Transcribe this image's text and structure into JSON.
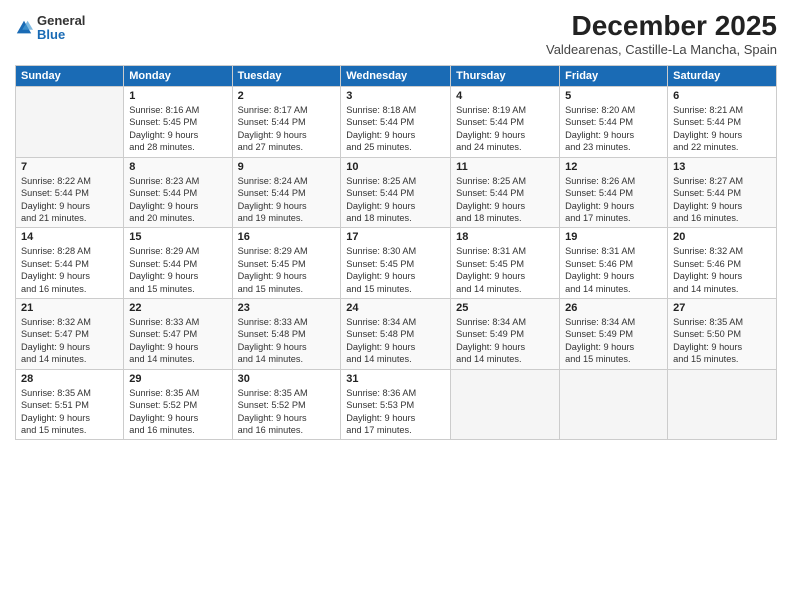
{
  "logo": {
    "general": "General",
    "blue": "Blue"
  },
  "header": {
    "title": "December 2025",
    "subtitle": "Valdearenas, Castille-La Mancha, Spain"
  },
  "calendar": {
    "days_of_week": [
      "Sunday",
      "Monday",
      "Tuesday",
      "Wednesday",
      "Thursday",
      "Friday",
      "Saturday"
    ],
    "weeks": [
      [
        {
          "day": "",
          "info": ""
        },
        {
          "day": "1",
          "info": "Sunrise: 8:16 AM\nSunset: 5:45 PM\nDaylight: 9 hours\nand 28 minutes."
        },
        {
          "day": "2",
          "info": "Sunrise: 8:17 AM\nSunset: 5:44 PM\nDaylight: 9 hours\nand 27 minutes."
        },
        {
          "day": "3",
          "info": "Sunrise: 8:18 AM\nSunset: 5:44 PM\nDaylight: 9 hours\nand 25 minutes."
        },
        {
          "day": "4",
          "info": "Sunrise: 8:19 AM\nSunset: 5:44 PM\nDaylight: 9 hours\nand 24 minutes."
        },
        {
          "day": "5",
          "info": "Sunrise: 8:20 AM\nSunset: 5:44 PM\nDaylight: 9 hours\nand 23 minutes."
        },
        {
          "day": "6",
          "info": "Sunrise: 8:21 AM\nSunset: 5:44 PM\nDaylight: 9 hours\nand 22 minutes."
        }
      ],
      [
        {
          "day": "7",
          "info": "Sunrise: 8:22 AM\nSunset: 5:44 PM\nDaylight: 9 hours\nand 21 minutes."
        },
        {
          "day": "8",
          "info": "Sunrise: 8:23 AM\nSunset: 5:44 PM\nDaylight: 9 hours\nand 20 minutes."
        },
        {
          "day": "9",
          "info": "Sunrise: 8:24 AM\nSunset: 5:44 PM\nDaylight: 9 hours\nand 19 minutes."
        },
        {
          "day": "10",
          "info": "Sunrise: 8:25 AM\nSunset: 5:44 PM\nDaylight: 9 hours\nand 18 minutes."
        },
        {
          "day": "11",
          "info": "Sunrise: 8:25 AM\nSunset: 5:44 PM\nDaylight: 9 hours\nand 18 minutes."
        },
        {
          "day": "12",
          "info": "Sunrise: 8:26 AM\nSunset: 5:44 PM\nDaylight: 9 hours\nand 17 minutes."
        },
        {
          "day": "13",
          "info": "Sunrise: 8:27 AM\nSunset: 5:44 PM\nDaylight: 9 hours\nand 16 minutes."
        }
      ],
      [
        {
          "day": "14",
          "info": "Sunrise: 8:28 AM\nSunset: 5:44 PM\nDaylight: 9 hours\nand 16 minutes."
        },
        {
          "day": "15",
          "info": "Sunrise: 8:29 AM\nSunset: 5:44 PM\nDaylight: 9 hours\nand 15 minutes."
        },
        {
          "day": "16",
          "info": "Sunrise: 8:29 AM\nSunset: 5:45 PM\nDaylight: 9 hours\nand 15 minutes."
        },
        {
          "day": "17",
          "info": "Sunrise: 8:30 AM\nSunset: 5:45 PM\nDaylight: 9 hours\nand 15 minutes."
        },
        {
          "day": "18",
          "info": "Sunrise: 8:31 AM\nSunset: 5:45 PM\nDaylight: 9 hours\nand 14 minutes."
        },
        {
          "day": "19",
          "info": "Sunrise: 8:31 AM\nSunset: 5:46 PM\nDaylight: 9 hours\nand 14 minutes."
        },
        {
          "day": "20",
          "info": "Sunrise: 8:32 AM\nSunset: 5:46 PM\nDaylight: 9 hours\nand 14 minutes."
        }
      ],
      [
        {
          "day": "21",
          "info": "Sunrise: 8:32 AM\nSunset: 5:47 PM\nDaylight: 9 hours\nand 14 minutes."
        },
        {
          "day": "22",
          "info": "Sunrise: 8:33 AM\nSunset: 5:47 PM\nDaylight: 9 hours\nand 14 minutes."
        },
        {
          "day": "23",
          "info": "Sunrise: 8:33 AM\nSunset: 5:48 PM\nDaylight: 9 hours\nand 14 minutes."
        },
        {
          "day": "24",
          "info": "Sunrise: 8:34 AM\nSunset: 5:48 PM\nDaylight: 9 hours\nand 14 minutes."
        },
        {
          "day": "25",
          "info": "Sunrise: 8:34 AM\nSunset: 5:49 PM\nDaylight: 9 hours\nand 14 minutes."
        },
        {
          "day": "26",
          "info": "Sunrise: 8:34 AM\nSunset: 5:49 PM\nDaylight: 9 hours\nand 15 minutes."
        },
        {
          "day": "27",
          "info": "Sunrise: 8:35 AM\nSunset: 5:50 PM\nDaylight: 9 hours\nand 15 minutes."
        }
      ],
      [
        {
          "day": "28",
          "info": "Sunrise: 8:35 AM\nSunset: 5:51 PM\nDaylight: 9 hours\nand 15 minutes."
        },
        {
          "day": "29",
          "info": "Sunrise: 8:35 AM\nSunset: 5:52 PM\nDaylight: 9 hours\nand 16 minutes."
        },
        {
          "day": "30",
          "info": "Sunrise: 8:35 AM\nSunset: 5:52 PM\nDaylight: 9 hours\nand 16 minutes."
        },
        {
          "day": "31",
          "info": "Sunrise: 8:36 AM\nSunset: 5:53 PM\nDaylight: 9 hours\nand 17 minutes."
        },
        {
          "day": "",
          "info": ""
        },
        {
          "day": "",
          "info": ""
        },
        {
          "day": "",
          "info": ""
        }
      ]
    ]
  }
}
